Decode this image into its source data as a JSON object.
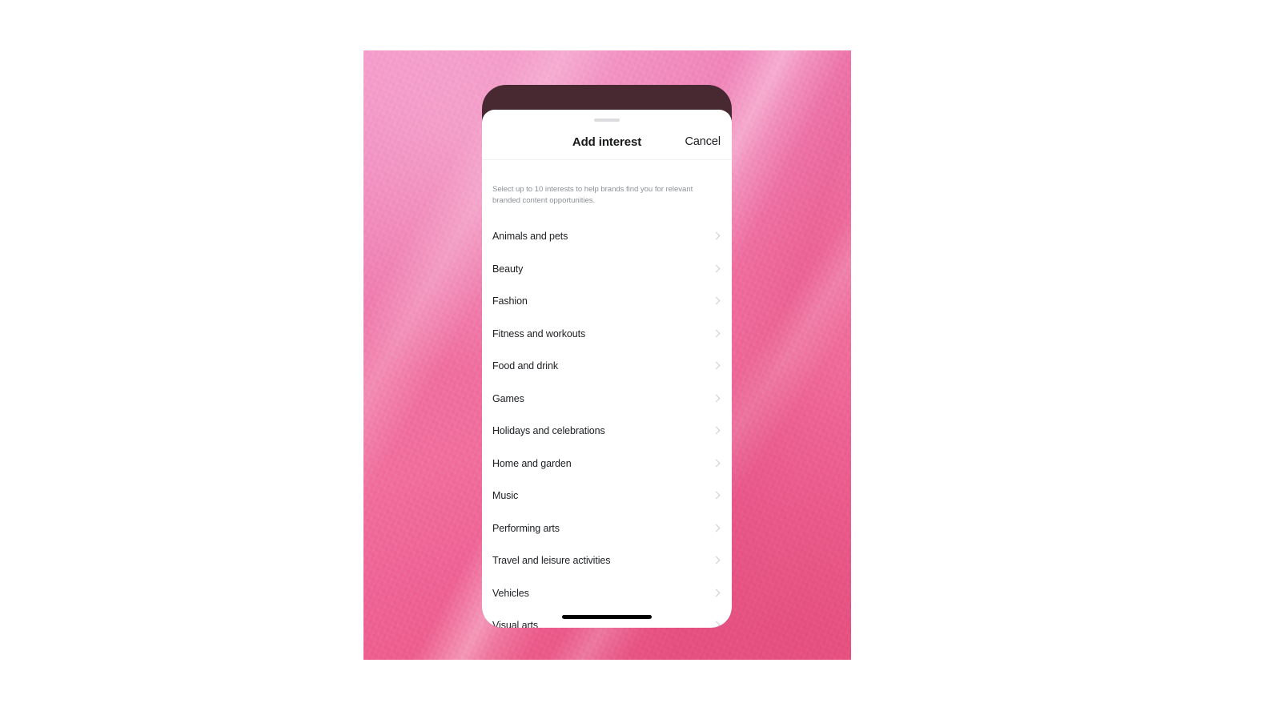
{
  "background": {
    "name": "pink-textured-photo",
    "colors": {
      "light_pink": "#f391c4",
      "mid_pink": "#ef6f9f",
      "deep_pink": "#ea5685"
    }
  },
  "phone": {
    "shell_color": "#482932",
    "home_indicator_color": "#010101"
  },
  "sheet": {
    "grabber_name": "drag-handle",
    "header": {
      "title": "Add interest",
      "cancel_label": "Cancel"
    },
    "subtitle": "Select up to 10 interests to help brands find you for relevant branded content opportunities.",
    "max_interests": 10,
    "list": [
      {
        "label": "Animals and pets",
        "chevron": "chevron-right-icon"
      },
      {
        "label": "Beauty",
        "chevron": "chevron-right-icon"
      },
      {
        "label": "Fashion",
        "chevron": "chevron-right-icon"
      },
      {
        "label": "Fitness and workouts",
        "chevron": "chevron-right-icon"
      },
      {
        "label": "Food and drink",
        "chevron": "chevron-right-icon"
      },
      {
        "label": "Games",
        "chevron": "chevron-right-icon"
      },
      {
        "label": "Holidays and celebrations",
        "chevron": "chevron-right-icon"
      },
      {
        "label": "Home and garden",
        "chevron": "chevron-right-icon"
      },
      {
        "label": "Music",
        "chevron": "chevron-right-icon"
      },
      {
        "label": "Performing arts",
        "chevron": "chevron-right-icon"
      },
      {
        "label": "Travel and leisure activities",
        "chevron": "chevron-right-icon"
      },
      {
        "label": "Vehicles",
        "chevron": "chevron-right-icon"
      },
      {
        "label": "Visual arts",
        "chevron": "chevron-right-icon"
      }
    ]
  }
}
